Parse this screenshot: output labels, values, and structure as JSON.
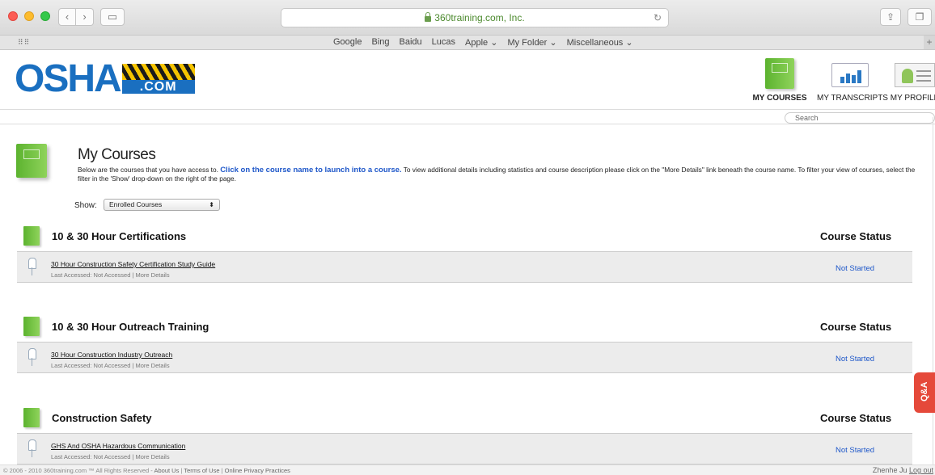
{
  "browser": {
    "url": "360training.com, Inc.",
    "bookmarks": [
      "Google",
      "Bing",
      "Baidu",
      "Lucas",
      "Apple ⌄",
      "My Folder ⌄",
      "Miscellaneous ⌄"
    ]
  },
  "logo": {
    "main": "OSHA",
    "suffix": ".COM"
  },
  "topnav": {
    "my_courses": "MY COURSES",
    "my_transcripts": "MY TRANSCRIPTS",
    "my_profile": "MY PROFILE"
  },
  "search": {
    "placeholder": "Search"
  },
  "intro": {
    "title": "My Courses",
    "text_before": "Below are the courses that you have access to. ",
    "text_highlight": "Click on the course name to launch into a course.",
    "text_after": " To view additional details including statistics and course description please click on the \"More Details\" link beneath the course name. To filter your view of courses, select the filter in the 'Show' drop-down on the right of the page."
  },
  "filter": {
    "label": "Show:",
    "selected": "Enrolled Courses"
  },
  "sections": [
    {
      "title": "10 & 30 Hour Certifications",
      "status_header": "Course Status",
      "course": {
        "name": "30 Hour Construction Safety Certification Study Guide",
        "meta": "Last Accessed: Not Accessed | More Details",
        "status": "Not Started"
      }
    },
    {
      "title": "10 & 30 Hour Outreach Training",
      "status_header": "Course Status",
      "course": {
        "name": "30 Hour Construction Industry Outreach",
        "meta": "Last Accessed: Not Accessed | More Details",
        "status": "Not Started"
      }
    },
    {
      "title": "Construction Safety",
      "status_header": "Course Status",
      "course": {
        "name": "GHS And OSHA Hazardous Communication",
        "meta": "Last Accessed: Not Accessed | More Details",
        "status": "Not Started"
      }
    }
  ],
  "qa_tab": "Q&A",
  "footer": {
    "copyright": "© 2006 - 2010 360training.com ™ All Rights Reserved - ",
    "links": [
      "About Us",
      "Terms of Use",
      "Online Privacy Practices"
    ],
    "user": "Zhenhe Ju",
    "logout": "Log out"
  },
  "colors": {
    "brand_blue": "#1a6fc0",
    "link_blue": "#1e57c9",
    "qa_red": "#e5493a",
    "book_green": "#5cb32f"
  },
  "icons": [
    "book-icon",
    "chart-icon",
    "profile-icon",
    "pin-icon",
    "lock-icon",
    "reload-icon",
    "share-icon"
  ]
}
